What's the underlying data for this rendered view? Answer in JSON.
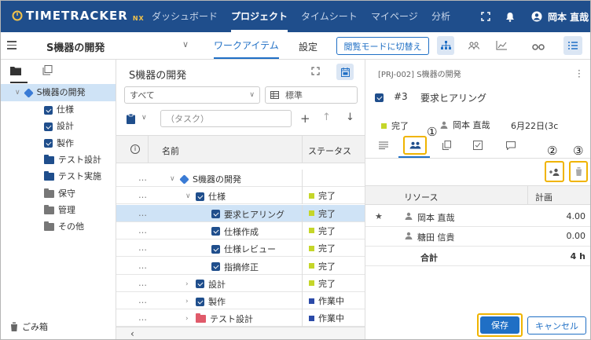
{
  "app": {
    "logo": "TIMETRACKER",
    "logo_suffix": "NX",
    "user": "岡本 直哉"
  },
  "nav": {
    "items": [
      "ダッシュボード",
      "プロジェクト",
      "タイムシート",
      "マイページ",
      "分析"
    ],
    "active": "プロジェクト"
  },
  "toolbar": {
    "project": "S機器の開発",
    "tab_work": "ワークアイテム",
    "tab_settings": "設定",
    "view_mode_button": "閲覧モードに切替え"
  },
  "sidebar": {
    "root": "S機器の開発",
    "items": [
      {
        "label": "仕様",
        "type": "check"
      },
      {
        "label": "設計",
        "type": "check"
      },
      {
        "label": "製作",
        "type": "check"
      },
      {
        "label": "テスト設計",
        "type": "folder-blue"
      },
      {
        "label": "テスト実施",
        "type": "folder-blue"
      },
      {
        "label": "保守",
        "type": "folder-gray"
      },
      {
        "label": "管理",
        "type": "folder-gray"
      },
      {
        "label": "その他",
        "type": "folder-gray"
      }
    ],
    "trash": "ごみ箱"
  },
  "mid": {
    "title": "S機器の開発",
    "filter": "すべて",
    "view": "標準",
    "task_placeholder": "（タスク）",
    "columns": {
      "name": "名前",
      "status": "ステータス"
    },
    "rows": [
      {
        "name": "S機器の開発",
        "status": "",
        "kind": "project",
        "indent": 0,
        "caret": "∨"
      },
      {
        "name": "仕様",
        "status": "完了",
        "kind": "check",
        "indent": 1,
        "caret": "∨",
        "color": "#c5d62a"
      },
      {
        "name": "要求ヒアリング",
        "status": "完了",
        "kind": "check",
        "indent": 2,
        "caret": "",
        "color": "#c5d62a",
        "selected": true
      },
      {
        "name": "仕様作成",
        "status": "完了",
        "kind": "check",
        "indent": 2,
        "caret": "",
        "color": "#c5d62a"
      },
      {
        "name": "仕様レビュー",
        "status": "完了",
        "kind": "check",
        "indent": 2,
        "caret": "",
        "color": "#c5d62a"
      },
      {
        "name": "指摘修正",
        "status": "完了",
        "kind": "check",
        "indent": 2,
        "caret": "",
        "color": "#c5d62a"
      },
      {
        "name": "設計",
        "status": "完了",
        "kind": "check",
        "indent": 1,
        "caret": "›",
        "color": "#c5d62a"
      },
      {
        "name": "製作",
        "status": "作業中",
        "kind": "check",
        "indent": 1,
        "caret": "›",
        "color": "#2b4aa8"
      },
      {
        "name": "テスト設計",
        "status": "作業中",
        "kind": "folder",
        "indent": 1,
        "caret": "›",
        "color": "#2b4aa8"
      }
    ]
  },
  "detail": {
    "breadcrumb": "[PRJ-002] S機器の開発",
    "item_no": "#3",
    "item_title": "要求ヒアリング",
    "status": "完了",
    "assignee": "岡本 直哉",
    "date": "6月22日(3c",
    "callouts": [
      "①",
      "②",
      "③"
    ],
    "table": {
      "headers": [
        "リソース",
        "計画"
      ],
      "rows": [
        {
          "name": "岡本 直哉",
          "plan": "4.00",
          "star": true
        },
        {
          "name": "糖田 信貴",
          "plan": "0.00",
          "star": false
        }
      ],
      "total_label": "合計",
      "total_value": "4 h"
    },
    "save": "保存",
    "cancel": "キャンセル"
  }
}
